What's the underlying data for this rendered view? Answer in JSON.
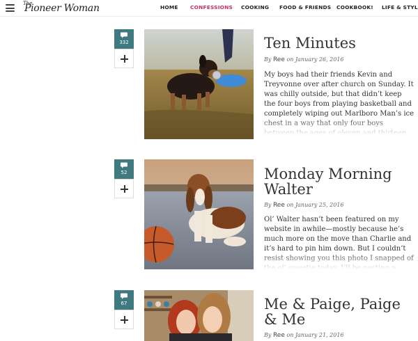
{
  "header": {
    "logo_small": "The",
    "logo_main": "Pioneer Woman",
    "nav": [
      "HOME",
      "CONFESSIONS",
      "COOKING",
      "FOOD & FRIENDS",
      "COOKBOOK!",
      "LIFE & STYLE"
    ],
    "active_nav": "CONFESSIONS",
    "active_color": "#c8325b"
  },
  "comment_badge_color": "#3e7a7f",
  "icons": {
    "menu": "hamburger-icon",
    "comments": "comment-bubble-icon",
    "add": "plus-icon"
  },
  "posts": [
    {
      "title": "Ten Minutes",
      "by": "By",
      "author": "Ree",
      "on": "on",
      "date": "January 26, 2016",
      "comments": "332",
      "image": "puppy-photo",
      "excerpt": "My boys had their friends Kevin and Treyvonne over after church on Sunday. It was chilly outside, but that didn’t keep the four boys from playing basketball and completely wiping out Marlboro Man’s ice chest in a way that only four boys between the ages of eleven and thirteen can do. I"
    },
    {
      "title": "Monday Morning Walter",
      "by": "By",
      "author": "Ree",
      "on": "on",
      "date": "January 25, 2016",
      "comments": "52",
      "image": "basset-hound-photo",
      "excerpt": "Ol’ Walter hasn’t been featured on my website in awhile—mostly because he’s much more on the move than Charlie and it’s hard to pin him down. But I couldn’t resist showing you this photo I snapped of the ol’ sweetie today. I’ll be posting a bunch"
    },
    {
      "title": "Me & Paige, Paige & Me",
      "by": "By",
      "author": "Ree",
      "on": "on",
      "date": "January 21, 2016",
      "comments": "67",
      "image": "selfie-photo",
      "excerpt": ""
    }
  ]
}
